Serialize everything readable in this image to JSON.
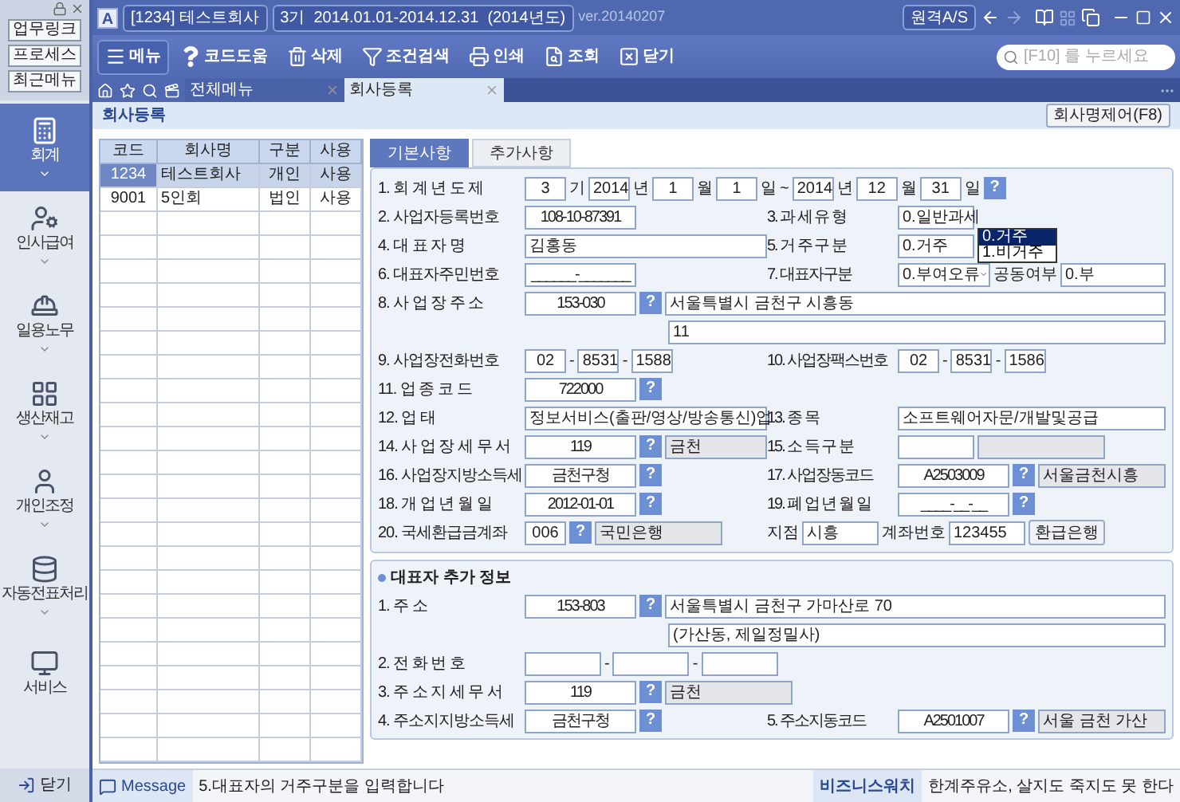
{
  "sidebar": {
    "quick_buttons": [
      "업무링크",
      "프로세스",
      "최근메뉴"
    ],
    "modules": [
      {
        "label": "회계",
        "kind": "calculator",
        "selected": true,
        "expandable": true
      },
      {
        "label": "인사급여",
        "kind": "person-card",
        "selected": false,
        "expandable": true
      },
      {
        "label": "일용노무",
        "kind": "worker",
        "selected": false,
        "expandable": true
      },
      {
        "label": "생산재고",
        "kind": "grid",
        "selected": false,
        "expandable": true
      },
      {
        "label": "개인조정",
        "kind": "person",
        "selected": false,
        "expandable": true
      },
      {
        "label": "자동전표처리",
        "kind": "database",
        "selected": false,
        "expandable": true
      },
      {
        "label": "서비스",
        "kind": "monitor",
        "selected": false,
        "expandable": false
      }
    ],
    "close": "닫기"
  },
  "titlebar": {
    "logo": "A",
    "company": "[1234] 테스트회사",
    "period": "3기  2014.01.01-2014.12.31  (2014년도)",
    "version": "ver.20140207",
    "remote_button": "원격A/S"
  },
  "toolbar": {
    "buttons": [
      {
        "label": "메뉴",
        "kind": "menu",
        "selected": true
      },
      {
        "label": "코드도움",
        "kind": "help",
        "selected": false
      },
      {
        "label": "삭제",
        "kind": "delete",
        "selected": false
      },
      {
        "label": "조건검색",
        "kind": "filter",
        "selected": false
      },
      {
        "label": "인쇄",
        "kind": "print",
        "selected": false
      },
      {
        "label": "조회",
        "kind": "search",
        "selected": false
      },
      {
        "label": "닫기",
        "kind": "close",
        "selected": false
      }
    ],
    "search": {
      "placeholder": "[F10] 를 누르세요"
    }
  },
  "tabs": [
    {
      "label": "전체메뉴",
      "selected": false
    },
    {
      "label": "회사등록",
      "selected": true
    }
  ],
  "page": {
    "title": "회사등록",
    "action_button": "회사명제어(F8)"
  },
  "company_table": {
    "columns": [
      "코드",
      "회사명",
      "구분",
      "사용"
    ],
    "rows": [
      {
        "cells": [
          "1234",
          "테스트회사",
          "개인",
          "사용"
        ],
        "selected": true
      },
      {
        "cells": [
          "9001",
          "5인회",
          "법인",
          "사용"
        ],
        "selected": false
      }
    ]
  },
  "form_tabs": [
    {
      "label": "기본사항",
      "selected": true
    },
    {
      "label": "추가사항",
      "selected": false
    }
  ],
  "form": {
    "rows": [
      {
        "cells": [
          {
            "label": "1. 회 계 년 도 제",
            "items": [
              {
                "kind": "small",
                "value": "3"
              },
              {
                "kind": "sep",
                "value": "기"
              },
              {
                "kind": "small",
                "value": "2014"
              },
              {
                "kind": "sep",
                "value": "년"
              },
              {
                "kind": "small",
                "value": "1"
              },
              {
                "kind": "sep",
                "value": "월"
              },
              {
                "kind": "small",
                "value": "1"
              },
              {
                "kind": "sep",
                "value": "일"
              },
              {
                "kind": "sep",
                "value": "~"
              },
              {
                "kind": "small",
                "value": "2014"
              },
              {
                "kind": "sep",
                "value": "년"
              },
              {
                "kind": "small",
                "value": "12"
              },
              {
                "kind": "sep",
                "value": "월"
              },
              {
                "kind": "small",
                "value": "31"
              },
              {
                "kind": "sep",
                "value": "일"
              },
              {
                "kind": "help",
                "value": "?"
              }
            ]
          }
        ]
      },
      {
        "cells": [
          {
            "label": "2. 사업자등록번호",
            "items": [
              {
                "kind": "code",
                "value": "108-10-87391"
              }
            ]
          },
          {
            "label": "3. 과 세 유 형",
            "items": [
              {
                "kind": "short",
                "value": "0.일반과세"
              }
            ]
          }
        ]
      },
      {
        "cells": [
          {
            "label": "4. 대 표 자 명",
            "items": [
              {
                "kind": "text",
                "value": "김홍동"
              }
            ]
          },
          {
            "label": "5. 거 주 구 분",
            "items": [
              {
                "kind": "short",
                "value": "0.거주",
                "options": [
                  {
                    "label": "0.거주",
                    "selected": true
                  },
                  {
                    "label": "1.비거주",
                    "selected": false
                  }
                ]
              }
            ]
          }
        ]
      },
      {
        "cells": [
          {
            "label": "6. 대표자주민번호",
            "items": [
              {
                "kind": "code",
                "value": "______-_______"
              }
            ]
          },
          {
            "label": "7. 대표자구분",
            "items": [
              {
                "kind": "select",
                "value": "0.부여오류"
              },
              {
                "kind": "sep",
                "value": "공동여부"
              },
              {
                "kind": "text",
                "value": "0.부"
              }
            ]
          }
        ]
      },
      {
        "cells": [
          {
            "label": "8. 사 업 장 주 소",
            "items": [
              {
                "kind": "code",
                "value": "153-030"
              },
              {
                "kind": "help",
                "value": "?"
              },
              {
                "kind": "text",
                "value": "서울특별시 금천구 시흥동"
              }
            ]
          }
        ]
      },
      {
        "cells": [
          {
            "items": [
              {
                "kind": "text",
                "value": "11"
              }
            ]
          }
        ]
      },
      {
        "cells": [
          {
            "label": "9. 사업장전화번호",
            "items": [
              {
                "kind": "small",
                "value": "02"
              },
              {
                "kind": "sep",
                "value": "-"
              },
              {
                "kind": "small",
                "value": "8531"
              },
              {
                "kind": "sep",
                "value": "-"
              },
              {
                "kind": "small",
                "value": "1588"
              }
            ]
          },
          {
            "label": "10. 사업장팩스번호",
            "items": [
              {
                "kind": "small",
                "value": "02"
              },
              {
                "kind": "sep",
                "value": "-"
              },
              {
                "kind": "small",
                "value": "8531"
              },
              {
                "kind": "sep",
                "value": "-"
              },
              {
                "kind": "small",
                "value": "1586"
              }
            ]
          }
        ]
      },
      {
        "cells": [
          {
            "label": "11. 업 종 코 드",
            "items": [
              {
                "kind": "code",
                "value": "722000"
              },
              {
                "kind": "help",
                "value": "?"
              }
            ]
          }
        ]
      },
      {
        "cells": [
          {
            "label": "12. 업 태",
            "items": [
              {
                "kind": "text",
                "value": "정보서비스(출판/영상/방송통신)업"
              }
            ]
          },
          {
            "label": "13. 종 목",
            "items": [
              {
                "kind": "text",
                "value": "소프트웨어자문/개발및공급"
              }
            ]
          }
        ]
      },
      {
        "cells": [
          {
            "label": "14. 사 업 장 세 무 서",
            "items": [
              {
                "kind": "code",
                "value": "119"
              },
              {
                "kind": "help",
                "value": "?"
              },
              {
                "kind": "ro",
                "value": "금천"
              }
            ]
          },
          {
            "label": "15. 소 득 구 분",
            "items": [
              {
                "kind": "short"
              },
              {
                "kind": "ro"
              }
            ]
          }
        ]
      },
      {
        "cells": [
          {
            "label": "16. 사업장지방소득세",
            "items": [
              {
                "kind": "code",
                "value": "금천구청"
              },
              {
                "kind": "help",
                "value": "?"
              }
            ]
          },
          {
            "label": "17. 사업장동코드",
            "items": [
              {
                "kind": "code",
                "value": "A2503009"
              },
              {
                "kind": "help",
                "value": "?"
              },
              {
                "kind": "ro",
                "value": "서울금천시흥"
              }
            ]
          }
        ]
      },
      {
        "cells": [
          {
            "label": "18. 개 업 년 월 일",
            "items": [
              {
                "kind": "code",
                "value": "2012-01-01"
              },
              {
                "kind": "help",
                "value": "?"
              }
            ]
          },
          {
            "label": "19. 폐 업 년 월 일",
            "items": [
              {
                "kind": "code",
                "value": "____-__-__"
              },
              {
                "kind": "help",
                "value": "?"
              }
            ]
          }
        ]
      },
      {
        "cells": [
          {
            "label": "20. 국세환급금계좌",
            "items": [
              {
                "kind": "small",
                "value": "006"
              },
              {
                "kind": "help",
                "value": "?"
              },
              {
                "kind": "ro",
                "value": "국민은행"
              }
            ]
          },
          {
            "items": [
              {
                "kind": "sep",
                "value": "지점"
              },
              {
                "kind": "short",
                "value": "시흥"
              },
              {
                "kind": "sep",
                "value": "계좌번호"
              },
              {
                "kind": "short",
                "value": "123455"
              },
              {
                "kind": "button",
                "value": "환급은행"
              }
            ]
          }
        ]
      }
    ]
  },
  "rep_info": {
    "title": "대표자 추가 정보",
    "rows": [
      {
        "cells": [
          {
            "label": "1. 주 소",
            "items": [
              {
                "kind": "code",
                "value": "153-803"
              },
              {
                "kind": "help",
                "value": "?"
              },
              {
                "kind": "text",
                "value": "서울특별시 금천구  가마산로 70"
              }
            ]
          }
        ]
      },
      {
        "cells": [
          {
            "items": [
              {
                "kind": "text",
                "value": "(가산동, 제일정밀사)"
              }
            ]
          }
        ]
      },
      {
        "cells": [
          {
            "label": "2. 전 화 번 호",
            "items": [
              {
                "kind": "short"
              },
              {
                "kind": "sep",
                "value": "-"
              },
              {
                "kind": "short"
              },
              {
                "kind": "sep",
                "value": "-"
              },
              {
                "kind": "short"
              }
            ]
          }
        ]
      },
      {
        "cells": [
          {
            "label": "3. 주 소 지 세 무 서",
            "items": [
              {
                "kind": "code",
                "value": "119"
              },
              {
                "kind": "help",
                "value": "?"
              },
              {
                "kind": "ro",
                "value": "금천"
              }
            ]
          }
        ]
      },
      {
        "cells": [
          {
            "label": "4. 주소지지방소득세",
            "items": [
              {
                "kind": "code",
                "value": "금천구청"
              },
              {
                "kind": "help",
                "value": "?"
              }
            ]
          },
          {
            "label": "5. 주소지동코드",
            "items": [
              {
                "kind": "code",
                "value": "A2501007"
              },
              {
                "kind": "help",
                "value": "?"
              },
              {
                "kind": "ro",
                "value": "서울 금천 가산"
              }
            ]
          }
        ]
      }
    ]
  },
  "status_bar": {
    "message_label": "Message",
    "message": "5.대표자의 거주구분을 입력합니다",
    "news_label": "비즈니스워치",
    "news": "한계주유소, 살지도 죽지도 못 한다"
  }
}
